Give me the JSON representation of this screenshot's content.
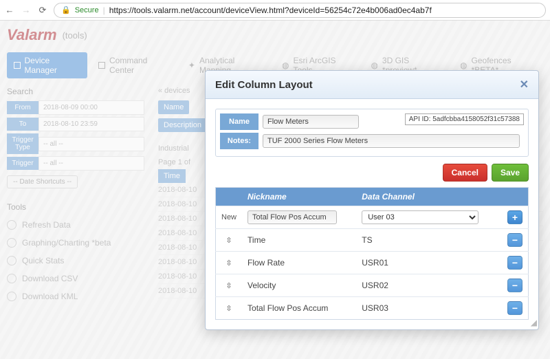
{
  "browser": {
    "secure_label": "Secure",
    "url": "https://tools.valarm.net/account/deviceView.html?deviceId=56254c72e4b006ad0ec4ab7f"
  },
  "brand": {
    "name": "Valarm",
    "context": "(tools)"
  },
  "nav": {
    "tabs": [
      {
        "label": "Device Manager"
      },
      {
        "label": "Command Center"
      },
      {
        "label": "Analytical Mapping"
      },
      {
        "label": "Esri ArcGIS Tools"
      },
      {
        "label": "3D GIS *preview*"
      },
      {
        "label": "Geofences *BETA*"
      }
    ]
  },
  "sidebar": {
    "search_label": "Search",
    "filters": {
      "from": {
        "label": "From",
        "value": "2018-08-09 00:00"
      },
      "to": {
        "label": "To",
        "value": "2018-08-10 23:59"
      },
      "trigger_type": {
        "label": "Trigger Type",
        "value": "-- all --"
      },
      "trigger": {
        "label": "Trigger",
        "value": "-- all --"
      }
    },
    "date_shortcuts_label": "-- Date Shortcuts --",
    "tools_label": "Tools",
    "tool_links": {
      "refresh": "Refresh Data",
      "graph": "Graphing/Charting *beta",
      "stats": "Quick Stats",
      "csv": "Download CSV",
      "kml": "Download KML"
    }
  },
  "main_bg": {
    "devices_link": "« devices",
    "name_label": "Name",
    "desc_label": "Description",
    "industrial_label": "Industrial",
    "pager": "Page 1 of",
    "time_col": "Time",
    "rows": [
      "2018-08-10",
      "2018-08-10",
      "2018-08-10",
      "2018-08-10",
      "2018-08-10",
      "2018-08-10",
      "2018-08-10",
      "2018-08-10"
    ]
  },
  "modal": {
    "title": "Edit Column Layout",
    "name_label": "Name",
    "name_value": "Flow Meters",
    "api_id_label": "API ID:",
    "api_id_value": "5adfcbba4158052f31c57388",
    "notes_label": "Notes:",
    "notes_value": "TUF 2000 Series Flow Meters",
    "cancel_label": "Cancel",
    "save_label": "Save",
    "th_nickname": "Nickname",
    "th_channel": "Data Channel",
    "new_label": "New",
    "new_nickname": "Total Flow Pos Accum",
    "new_channel": "User 03",
    "rows": [
      {
        "nickname": "Time",
        "channel": "TS"
      },
      {
        "nickname": "Flow Rate",
        "channel": "USR01"
      },
      {
        "nickname": "Velocity",
        "channel": "USR02"
      },
      {
        "nickname": "Total Flow Pos Accum",
        "channel": "USR03"
      }
    ]
  }
}
